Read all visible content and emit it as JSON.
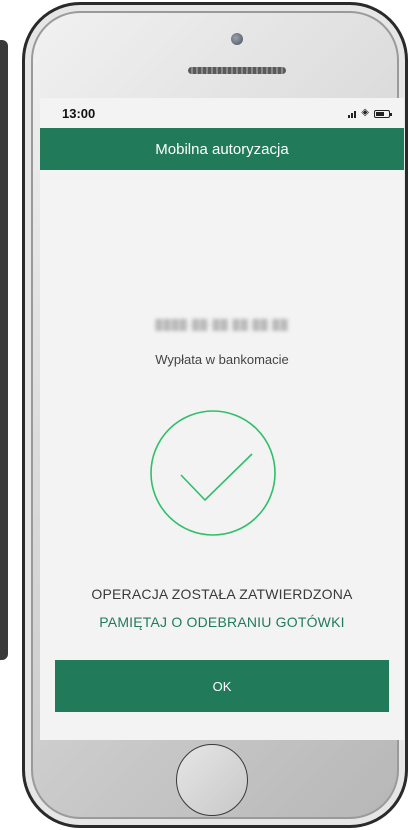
{
  "status_bar": {
    "time": "13:00",
    "wifi_icon": "wifi-icon",
    "signal_icon": "signal-icon",
    "battery_icon": "battery-icon"
  },
  "header": {
    "title": "Mobilna autoryzacja"
  },
  "transaction": {
    "operation": "Wypłata w bankomacie",
    "status": "OPERACJA ZOSTAŁA ZATWIERDZONA",
    "reminder": "PAMIĘTAJ O ODEBRANIU GOTÓWKI",
    "success_icon": "checkmark-circle-icon"
  },
  "actions": {
    "ok_label": "OK"
  },
  "colors": {
    "brand_green": "#217b5b",
    "check_green": "#2fbf6a",
    "screen_bg": "#f3f3f3"
  }
}
